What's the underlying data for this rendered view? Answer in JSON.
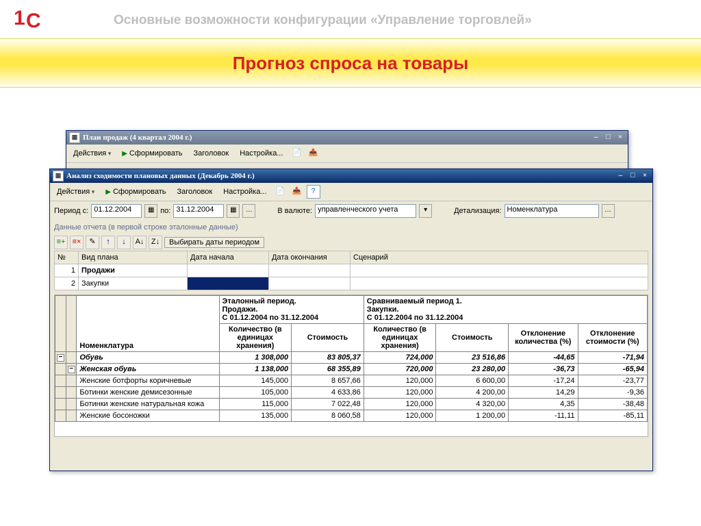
{
  "presentation": {
    "caption": "Основные возможности конфигурации «Управление торговлей»",
    "heading": "Прогноз спроса на товары"
  },
  "back_window": {
    "title": "План продаж (4 квартал 2004 г.)",
    "actions_label": "Действия",
    "form_label": "Сформировать",
    "header_label": "Заголовок",
    "settings_label": "Настройка..."
  },
  "front_window": {
    "title": "Анализ сходимости плановых данных (Декабрь 2004 г.)",
    "actions_label": "Действия",
    "form_label": "Сформировать",
    "header_label": "Заголовок",
    "settings_label": "Настройка...",
    "period_from_label": "Период с:",
    "period_from": "01.12.2004",
    "period_to_label": "по:",
    "period_to": "31.12.2004",
    "currency_label": "В валюте:",
    "currency_value": "управленческого учета",
    "detail_label": "Детализация:",
    "detail_value": "Номенклатура",
    "section_label": "Данные отчета (в первой строке эталонные данные)",
    "period_btn": "Выбирать даты периодом",
    "grid_cols": {
      "c1": "№",
      "c2": "Вид плана",
      "c3": "Дата начала",
      "c4": "Дата окончания",
      "c5": "Сценарий"
    },
    "grid_rows": [
      {
        "n": "1",
        "plan": "Продажи"
      },
      {
        "n": "2",
        "plan": "Закупки"
      }
    ],
    "report": {
      "nomen_label": "Номенклатура",
      "ref_header_l1": "Эталонный период.",
      "ref_header_l2": "Продажи.",
      "ref_header_l3": "С 01.12.2004 по 31.12.2004",
      "cmp_header_l1": "Сравниваемый период 1.",
      "cmp_header_l2": "Закупки.",
      "cmp_header_l3": "С 01.12.2004 по 31.12.2004",
      "qty_label": "Количество (в единицах хранения)",
      "cost_label": "Стоимость",
      "dev_qty_label": "Отклонение количества (%)",
      "dev_cost_label": "Отклонение стоимости (%)",
      "rows": [
        {
          "name": "Обувь",
          "group": true,
          "qty1": "1 308,000",
          "cost1": "83 805,37",
          "qty2": "724,000",
          "cost2": "23 516,86",
          "dq": "-44,65",
          "dc": "-71,94"
        },
        {
          "name": "Женская обувь",
          "group": true,
          "qty1": "1 138,000",
          "cost1": "68 355,89",
          "qty2": "720,000",
          "cost2": "23 280,00",
          "dq": "-36,73",
          "dc": "-65,94"
        },
        {
          "name": "Женские ботфорты коричневые",
          "qty1": "145,000",
          "cost1": "8 657,66",
          "qty2": "120,000",
          "cost2": "6 600,00",
          "dq": "-17,24",
          "dc": "-23,77"
        },
        {
          "name": "Ботинки женские демисезонные",
          "qty1": "105,000",
          "cost1": "4 633,86",
          "qty2": "120,000",
          "cost2": "4 200,00",
          "dq": "14,29",
          "dc": "-9,36"
        },
        {
          "name": "Ботинки женские натуральная кожа",
          "qty1": "115,000",
          "cost1": "7 022,48",
          "qty2": "120,000",
          "cost2": "4 320,00",
          "dq": "4,35",
          "dc": "-38,48"
        },
        {
          "name": "Женские босоножки",
          "qty1": "135,000",
          "cost1": "8 060,58",
          "qty2": "120,000",
          "cost2": "1 200,00",
          "dq": "-11,11",
          "dc": "-85,11"
        }
      ]
    }
  }
}
